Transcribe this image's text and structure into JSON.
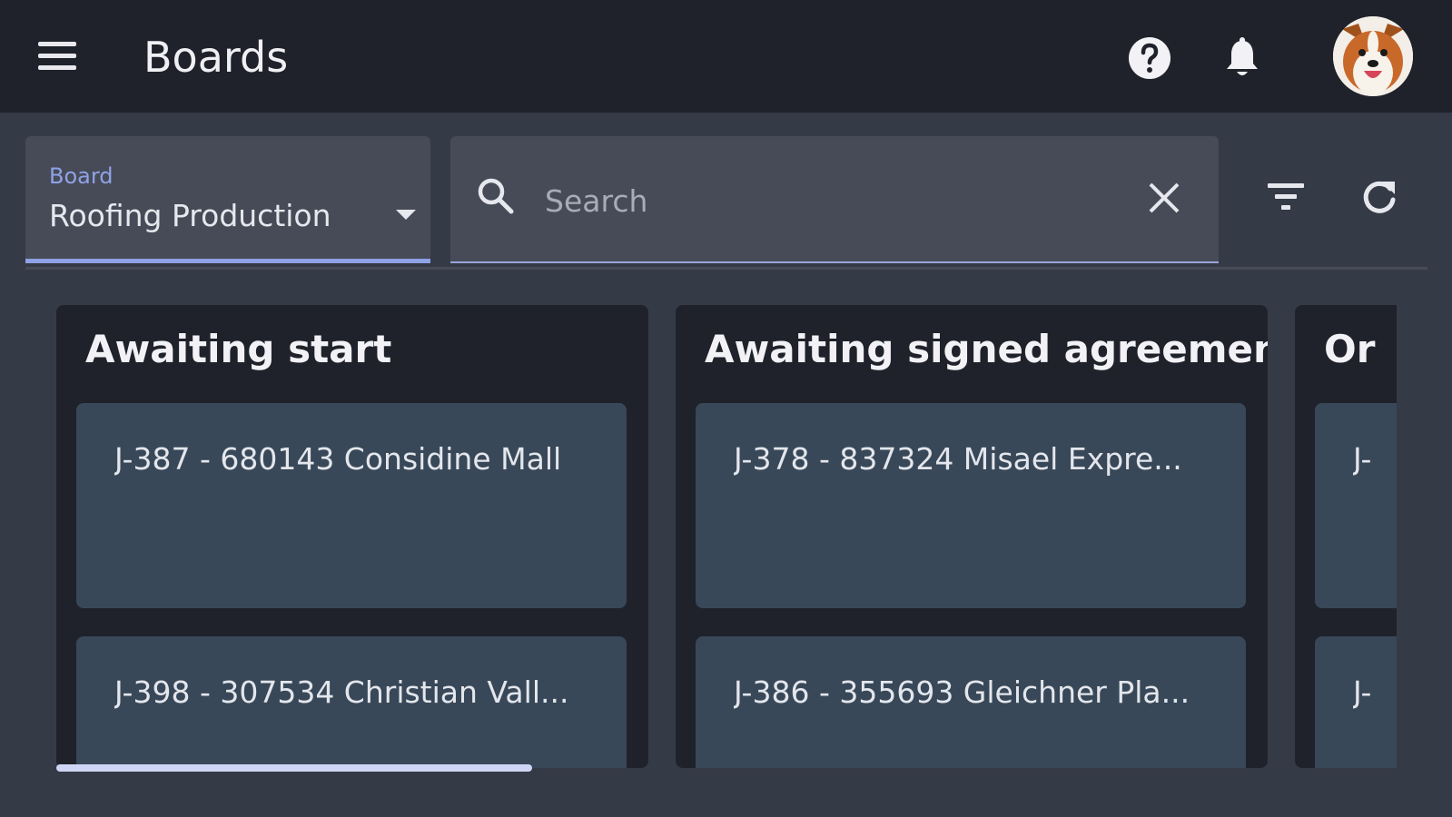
{
  "app": {
    "title": "Boards"
  },
  "header": {
    "icons": [
      "menu-icon",
      "help-icon",
      "bell-icon",
      "avatar"
    ],
    "colors": {
      "bar": "#20222b",
      "accent": "#8fa2e6"
    }
  },
  "board_select": {
    "label": "Board",
    "value": "Roofing Production"
  },
  "search": {
    "placeholder": "Search",
    "value": ""
  },
  "toolbar_icons": [
    "filter-icon",
    "refresh-icon"
  ],
  "columns": [
    {
      "title": "Awaiting start",
      "cards": [
        "J-387 - 680143 Considine Mall",
        "J-398 - 307534 Christian Vall..."
      ]
    },
    {
      "title": "Awaiting signed agreement",
      "cards": [
        "J-378 - 837324 Misael Expre...",
        "J-386 - 355693 Gleichner Pla..."
      ]
    },
    {
      "title": "Or",
      "cards": [
        "J-",
        "J-"
      ]
    }
  ],
  "scroll": {
    "visible_fraction": 0.35
  }
}
